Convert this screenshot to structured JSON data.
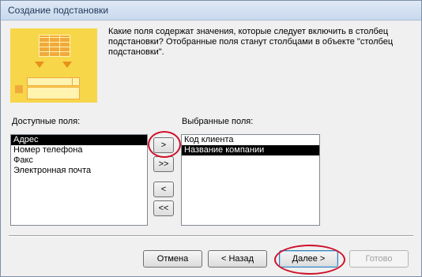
{
  "window": {
    "title": "Создание подстановки"
  },
  "description": "Какие поля содержат значения, которые следует включить в столбец подстановки? Отобранные поля станут столбцами в объекте \"столбец подстановки\".",
  "available": {
    "label": "Доступные поля:",
    "items": [
      "Адрес",
      "Номер телефона",
      "Факс",
      "Электронная почта"
    ],
    "selected_index": 0
  },
  "chosen": {
    "label": "Выбранные поля:",
    "items": [
      "Код клиента",
      "Название компании"
    ],
    "selected_index": 1
  },
  "move_buttons": {
    "add_one": ">",
    "add_all": ">>",
    "remove_one": "<",
    "remove_all": "<<"
  },
  "footer": {
    "cancel": "Отмена",
    "back": "< Назад",
    "next": "Далее >",
    "finish": "Готово"
  },
  "colors": {
    "highlight_ring": "#d0102a",
    "illustration_bg": "#f7d64a",
    "illustration_accent": "#e8901b"
  }
}
